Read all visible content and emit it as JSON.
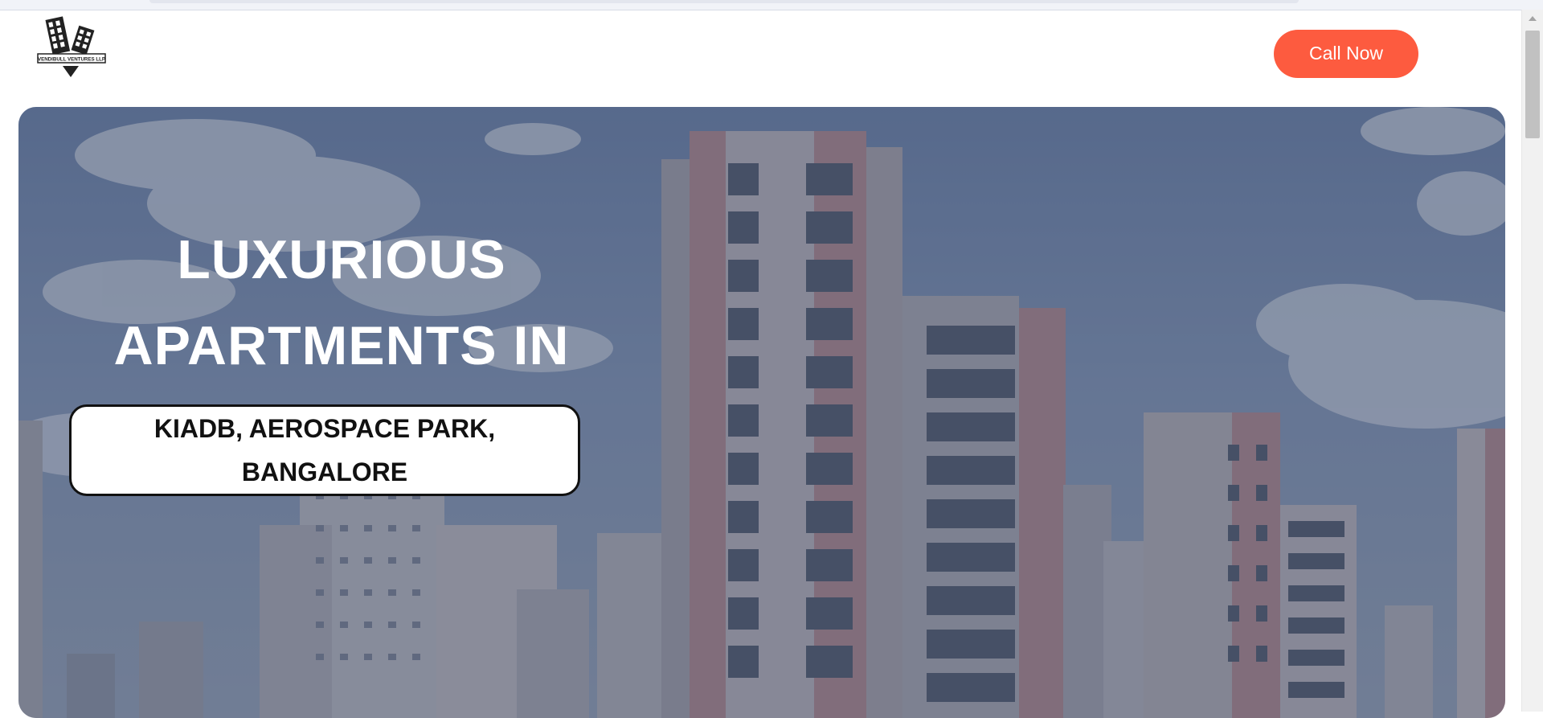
{
  "header": {
    "logo": {
      "icon": "building-v-logo-icon",
      "text": "VENDIBULL VENTURES LLP"
    },
    "call_button_label": "Call Now"
  },
  "hero": {
    "headline_line1": "LUXURIOUS",
    "headline_line2": "APARTMENTS IN",
    "location": "KIADB, AEROSPACE PARK, BANGALORE",
    "background": "city-apartments-photo"
  },
  "colors": {
    "accent": "#fd5b3f",
    "text_on_hero": "#ffffff",
    "location_box_bg": "#ffffff",
    "location_box_border": "#111111"
  }
}
